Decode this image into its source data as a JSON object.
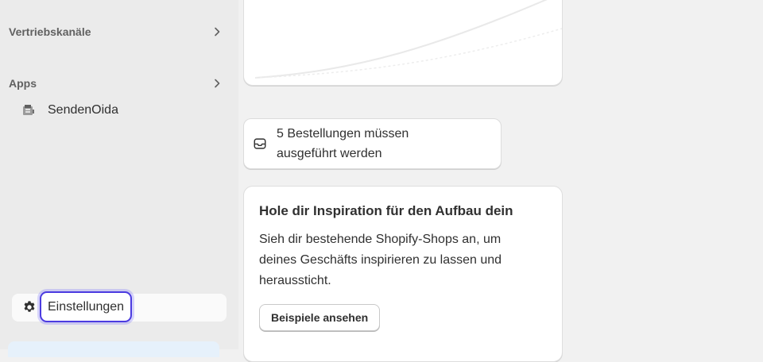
{
  "sidebar": {
    "sales_channels_label": "Vertriebskanäle",
    "apps_label": "Apps",
    "apps": [
      {
        "label": "SendenOida",
        "icon": "app-icon"
      }
    ],
    "settings_label": "Einstellungen"
  },
  "main": {
    "orders_card": {
      "line1": "5 Bestellungen müssen",
      "line2": "ausgeführt werden",
      "icon": "inbox-icon"
    },
    "inspiration_card": {
      "title": "Hole dir Inspiration für den Aufbau dein",
      "body_lines": [
        "Sieh dir bestehende Shopify-Shops an, um",
        "deines Geschäfts inspirieren zu lassen und",
        "heraussticht."
      ],
      "button_label": "Beispiele ansehen"
    }
  },
  "colors": {
    "focus_ring": "#4b3be0",
    "sidebar_bg": "#ebebeb",
    "page_bg": "#f1f1f1"
  }
}
